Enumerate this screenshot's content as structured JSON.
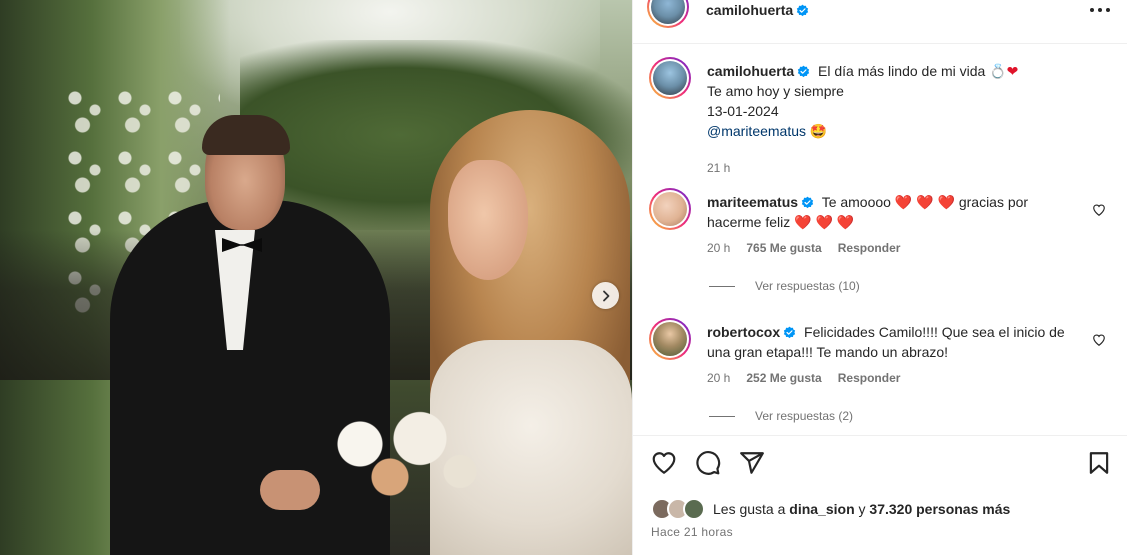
{
  "post": {
    "author": "camilohuerta",
    "caption": {
      "line1": "El día más lindo de mi vida 💍",
      "line2": "Te amo hoy y siempre",
      "line3": "13-01-2024",
      "mention": "@mariteematus",
      "mention_emoji": "🤩",
      "time": "21 h"
    }
  },
  "comments": [
    {
      "author": "mariteematus",
      "text_a": "Te amoooo",
      "text_b": "gracias por",
      "text_c": "hacerme feliz",
      "time": "20 h",
      "likes": "765 Me gusta",
      "reply": "Responder",
      "view_replies": "Ver respuestas (10)"
    },
    {
      "author": "robertocox",
      "text_a": "Felicidades Camilo!!!! Que sea el inicio de",
      "text_b": "una gran etapa!!! Te mando un abrazo!",
      "time": "20 h",
      "likes": "252 Me gusta",
      "reply": "Responder",
      "view_replies": "Ver respuestas (2)"
    }
  ],
  "likes": {
    "prefix": "Les gusta a",
    "user": "dina_sion",
    "conj": "y",
    "others": "37.320 personas más"
  },
  "posted_ago": "Hace 21 horas",
  "icons": {
    "verified": "verified-badge-icon",
    "heart": "heart-icon",
    "comment": "comment-icon",
    "share": "share-icon",
    "save": "bookmark-icon",
    "more": "more-horizontal-icon",
    "next": "chevron-right-icon"
  },
  "colors": {
    "verified": "#0095f6",
    "text": "#262626",
    "muted": "#737373",
    "heart": "#e0142b"
  }
}
